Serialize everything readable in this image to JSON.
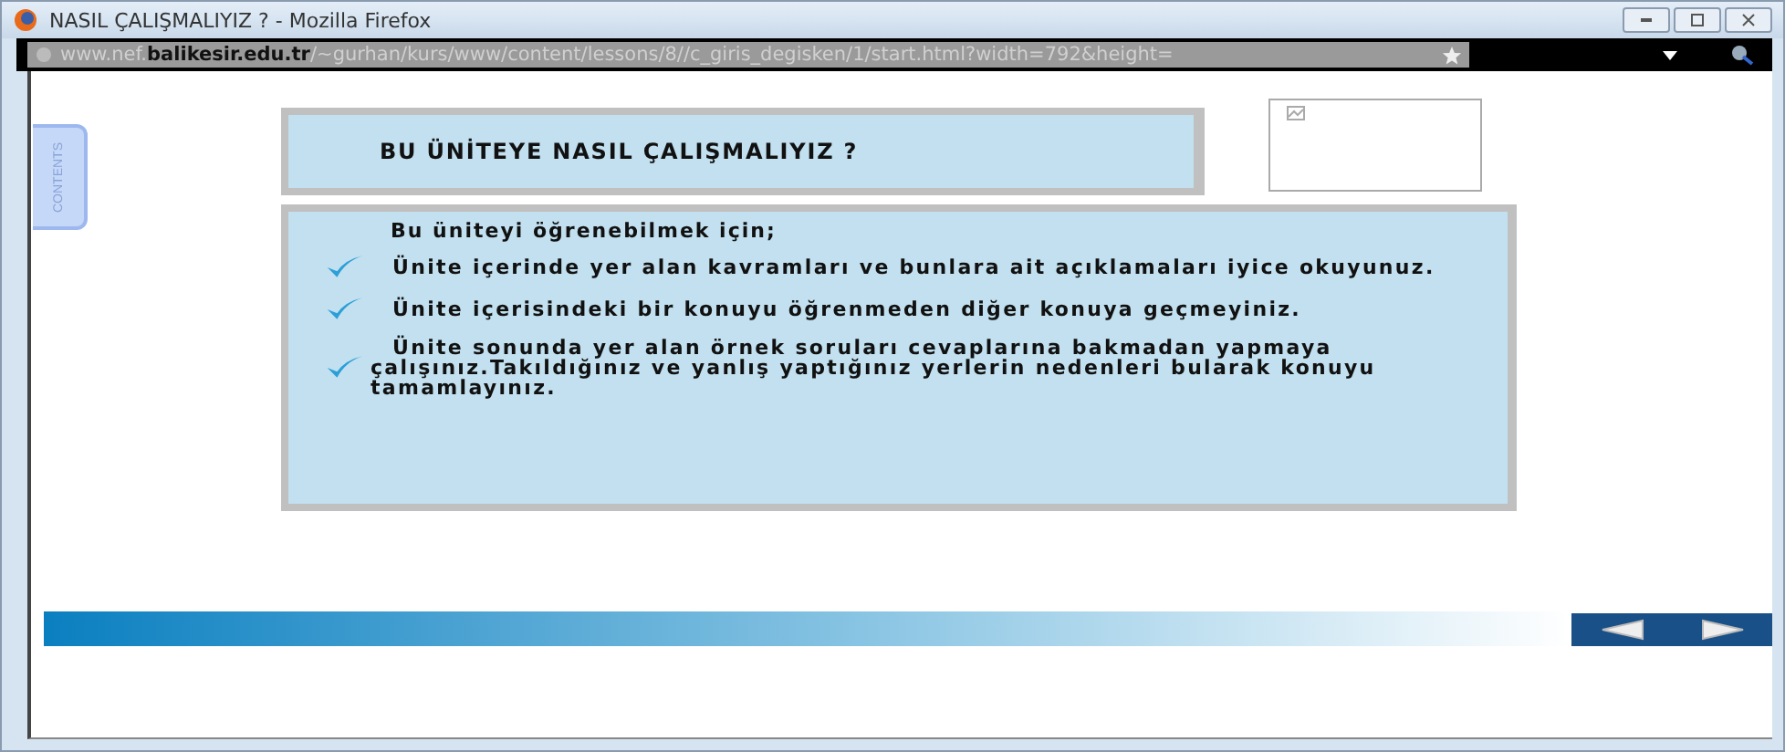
{
  "window": {
    "title": "NASIL ÇALIŞMALIYIZ ? - Mozilla Firefox"
  },
  "address_bar": {
    "url": "www.nef.**balikesir.edu.tr**/~gurhan/kurs/www/content/lessons/8//c_giris_degisken/1/start.html?width=792&height="
  },
  "side_tab": {
    "label": "CONTENTS"
  },
  "lesson": {
    "heading": "BU ÜNİTEYE NASIL ÇALIŞMALIYIZ ?",
    "intro": "Bu üniteyi öğrenebilmek için;",
    "items": [
      {
        "text": "Ünite içerinde yer alan kavramları ve bunlara ait açıklamaları iyice okuyunuz.",
        "checked": true
      },
      {
        "text": "Ünite içerisindeki bir konuyu öğrenmeden diğer konuya geçmeyiniz.",
        "checked": true
      },
      {
        "text": "Ünite sonunda yer alan örnek soruları cevaplarına bakmadan yapmaya çalışınız.Takıldığınız ve yanlış yaptığınız yerlerin nedenleri bularak konuyu tamamlayınız.",
        "checked": true
      }
    ]
  }
}
